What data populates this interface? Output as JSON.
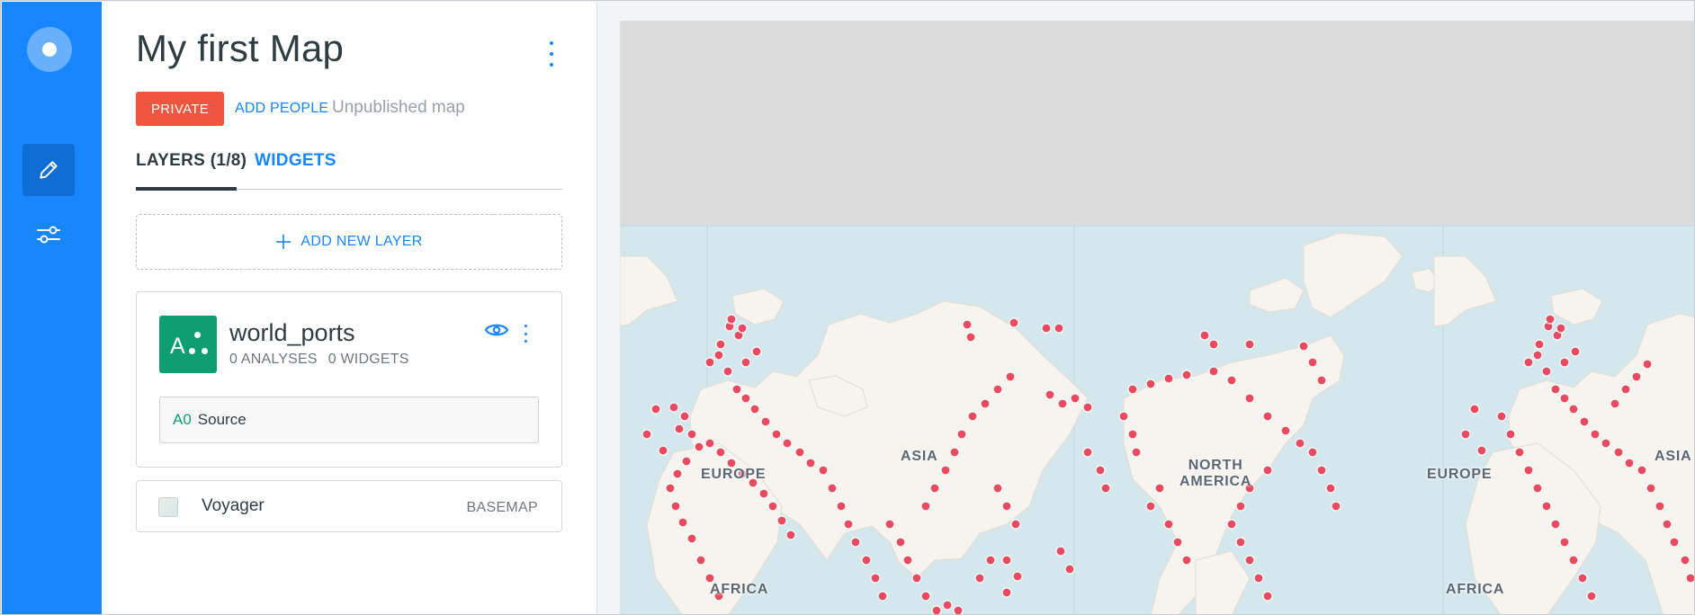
{
  "rail": {
    "items": [
      {
        "name": "builder-logo-icon"
      },
      {
        "name": "edit-pencil-icon",
        "active": true
      },
      {
        "name": "sliders-icon",
        "active": false
      }
    ]
  },
  "header": {
    "title": "My first Map",
    "privacy_badge": "PRIVATE",
    "add_people": "ADD PEOPLE",
    "status": "Unpublished map"
  },
  "tabs": [
    {
      "label": "LAYERS (1/8)",
      "active": true
    },
    {
      "label": "WIDGETS",
      "active": false
    }
  ],
  "add_layer": {
    "label": "ADD NEW LAYER",
    "icon": "plus-icon"
  },
  "layer": {
    "badge_letter": "A",
    "name": "world_ports",
    "analyses": "0 ANALYSES",
    "widgets": "0 WIDGETS",
    "source": {
      "id": "A0",
      "label": "Source"
    }
  },
  "basemap": {
    "name": "Voyager",
    "tag": "BASEMAP"
  },
  "map": {
    "labels": {
      "europe_1": "EUROPE",
      "asia_1": "ASIA",
      "north_america": "NORTH\nAMERICA",
      "europe_2": "EUROPE",
      "asia_2": "ASIA",
      "africa_1": "AFRICA",
      "africa_2": "AFRICA"
    }
  },
  "colors": {
    "rail": "#1785fb",
    "accent": "#1785fb",
    "private_badge": "#f2553d",
    "layer_badge": "#0f9d72",
    "port_points": "#e84a5f",
    "ocean": "#d4e7ec",
    "land": "#f7f3ee",
    "map_empty": "#dcdcdc"
  }
}
